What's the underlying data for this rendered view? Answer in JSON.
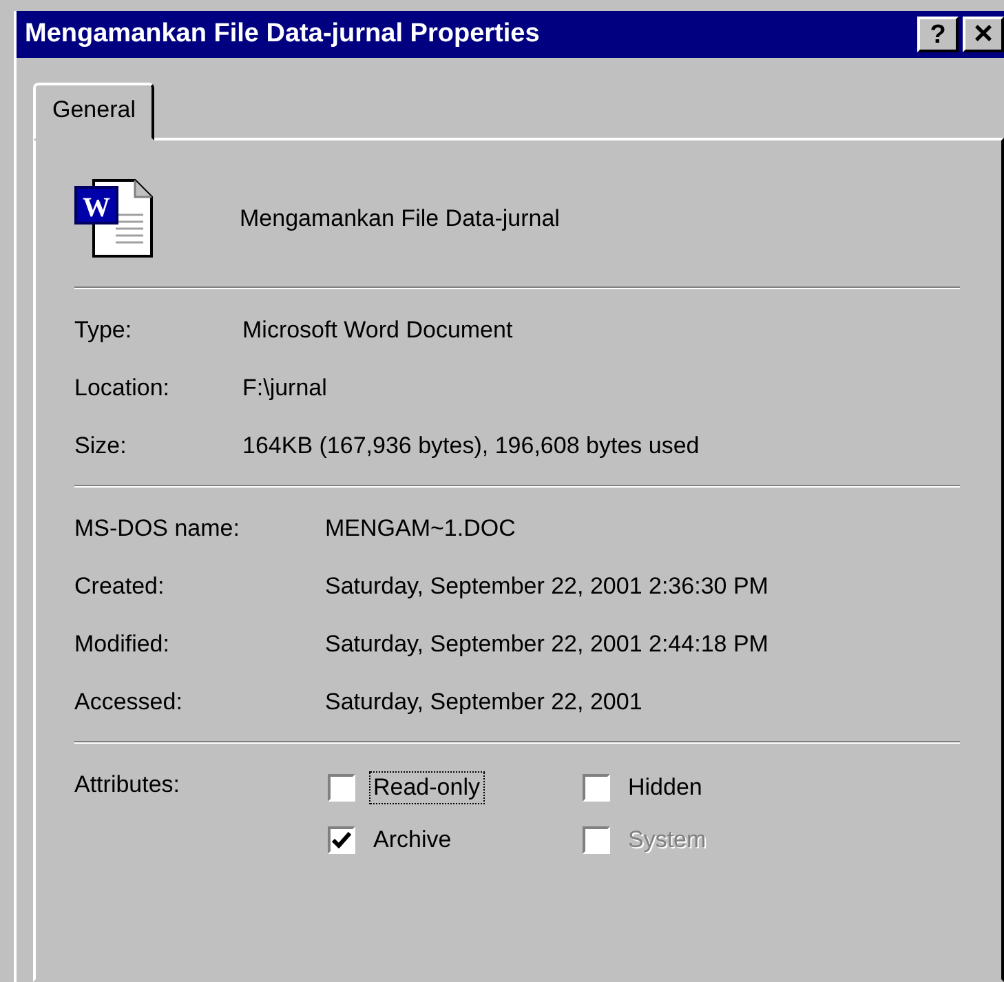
{
  "window": {
    "title": "Mengamankan File Data-jurnal Properties",
    "buttons": [
      {
        "kind": "help",
        "label": "?"
      },
      {
        "kind": "close",
        "label": "×"
      }
    ]
  },
  "tabs": [
    {
      "label": "General",
      "selected": true
    }
  ],
  "file": {
    "icon_letter": "W",
    "name": "Mengamankan File Data-jurnal"
  },
  "groups": [
    [
      {
        "label": "Type:",
        "value": "Microsoft Word Document"
      },
      {
        "label": "Location:",
        "value": "F:\\jurnal"
      },
      {
        "label": "Size:",
        "value": "164KB (167,936 bytes), 196,608 bytes used"
      }
    ],
    [
      {
        "label": "MS-DOS name:",
        "value": "MENGAM~1.DOC"
      },
      {
        "label": "Created:",
        "value": "Saturday, September 22, 2001 2:36:30 PM"
      },
      {
        "label": "Modified:",
        "value": "Saturday, September 22, 2001 2:44:18 PM"
      },
      {
        "label": "Accessed:",
        "value": "Saturday, September 22, 2001"
      }
    ]
  ],
  "attributes": {
    "label": "Attributes:",
    "items": [
      {
        "label": "Read-only",
        "checked": false,
        "disabled": false,
        "focused": true
      },
      {
        "label": "Hidden",
        "checked": false,
        "disabled": false,
        "focused": false
      },
      {
        "label": "Archive",
        "checked": true,
        "disabled": false,
        "focused": false
      },
      {
        "label": "System",
        "checked": false,
        "disabled": true,
        "focused": false
      }
    ]
  }
}
